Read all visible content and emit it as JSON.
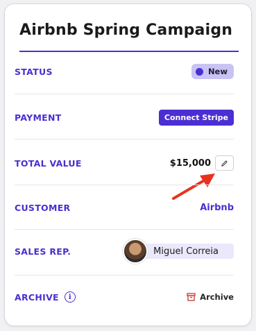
{
  "card": {
    "title": "Airbnb Spring Campaign"
  },
  "rows": {
    "status": {
      "label": "STATUS",
      "badge": "New"
    },
    "payment": {
      "label": "PAYMENT",
      "button": "Connect Stripe"
    },
    "total_value": {
      "label": "TOTAL VALUE",
      "amount": "$15,000"
    },
    "customer": {
      "label": "CUSTOMER",
      "value": "Airbnb"
    },
    "sales_rep": {
      "label": "SALES REP.",
      "name": "Miguel Correia"
    },
    "archive": {
      "label": "ARCHIVE",
      "button": "Archive",
      "info_glyph": "i"
    }
  },
  "colors": {
    "accent": "#4b2fd2",
    "label": "#4a2fcf",
    "badge_bg": "#c9c3f3",
    "archive_icon": "#d0342c",
    "annotation_arrow": "#e8321f"
  },
  "icons": [
    "pencil-icon",
    "archive-box-icon",
    "info-icon",
    "avatar"
  ]
}
